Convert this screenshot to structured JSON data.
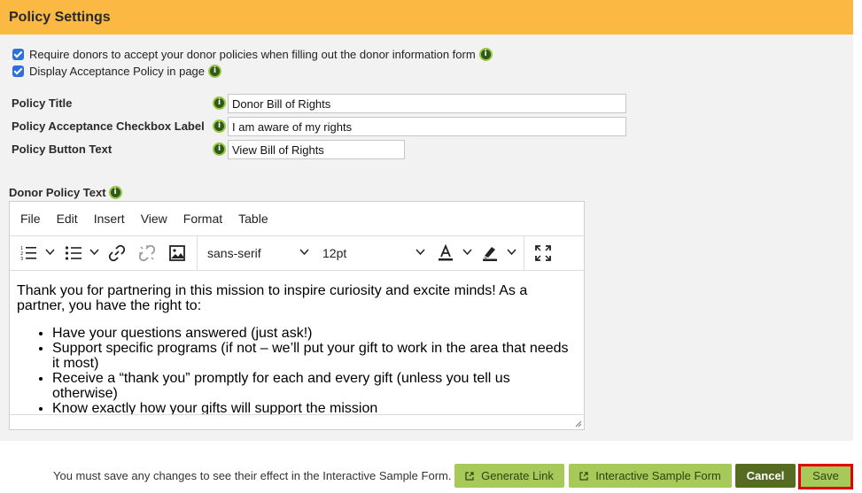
{
  "header": {
    "title": "Policy Settings"
  },
  "checkboxes": [
    {
      "label": "Require donors to accept your donor policies when filling out the donor information form",
      "checked": true
    },
    {
      "label": "Display Acceptance Policy in page",
      "checked": true
    }
  ],
  "fields": {
    "policy_title": {
      "label": "Policy Title",
      "value": "Donor Bill of Rights"
    },
    "checkbox_label": {
      "label": "Policy Acceptance Checkbox Label",
      "value": "I am aware of my rights"
    },
    "button_text": {
      "label": "Policy Button Text",
      "value": "View Bill of Rights"
    }
  },
  "editor": {
    "label": "Donor Policy Text",
    "menu": [
      "File",
      "Edit",
      "Insert",
      "View",
      "Format",
      "Table"
    ],
    "font_family": "sans-serif",
    "font_size": "12pt",
    "intro": "Thank you for partnering in this mission to inspire curiosity and excite minds!  As a partner, you have the right to:",
    "bullets": [
      "Have your questions answered (just ask!)",
      "Support specific programs (if not – we’ll put your gift to work in the area that needs it most)",
      "Receive a “thank you” promptly for each and every gift (unless you tell us otherwise)",
      "Know exactly how your gifts will support the mission"
    ]
  },
  "footer": {
    "note": "You must save any changes to see their effect in the Interactive Sample Form.",
    "generate_link": "Generate Link",
    "sample_form": "Interactive Sample Form",
    "cancel": "Cancel",
    "save": "Save"
  },
  "colors": {
    "header_bg": "#fbb843",
    "accent_green": "#a6c95a",
    "cancel_bg": "#556b22",
    "highlight": "#e60000"
  }
}
